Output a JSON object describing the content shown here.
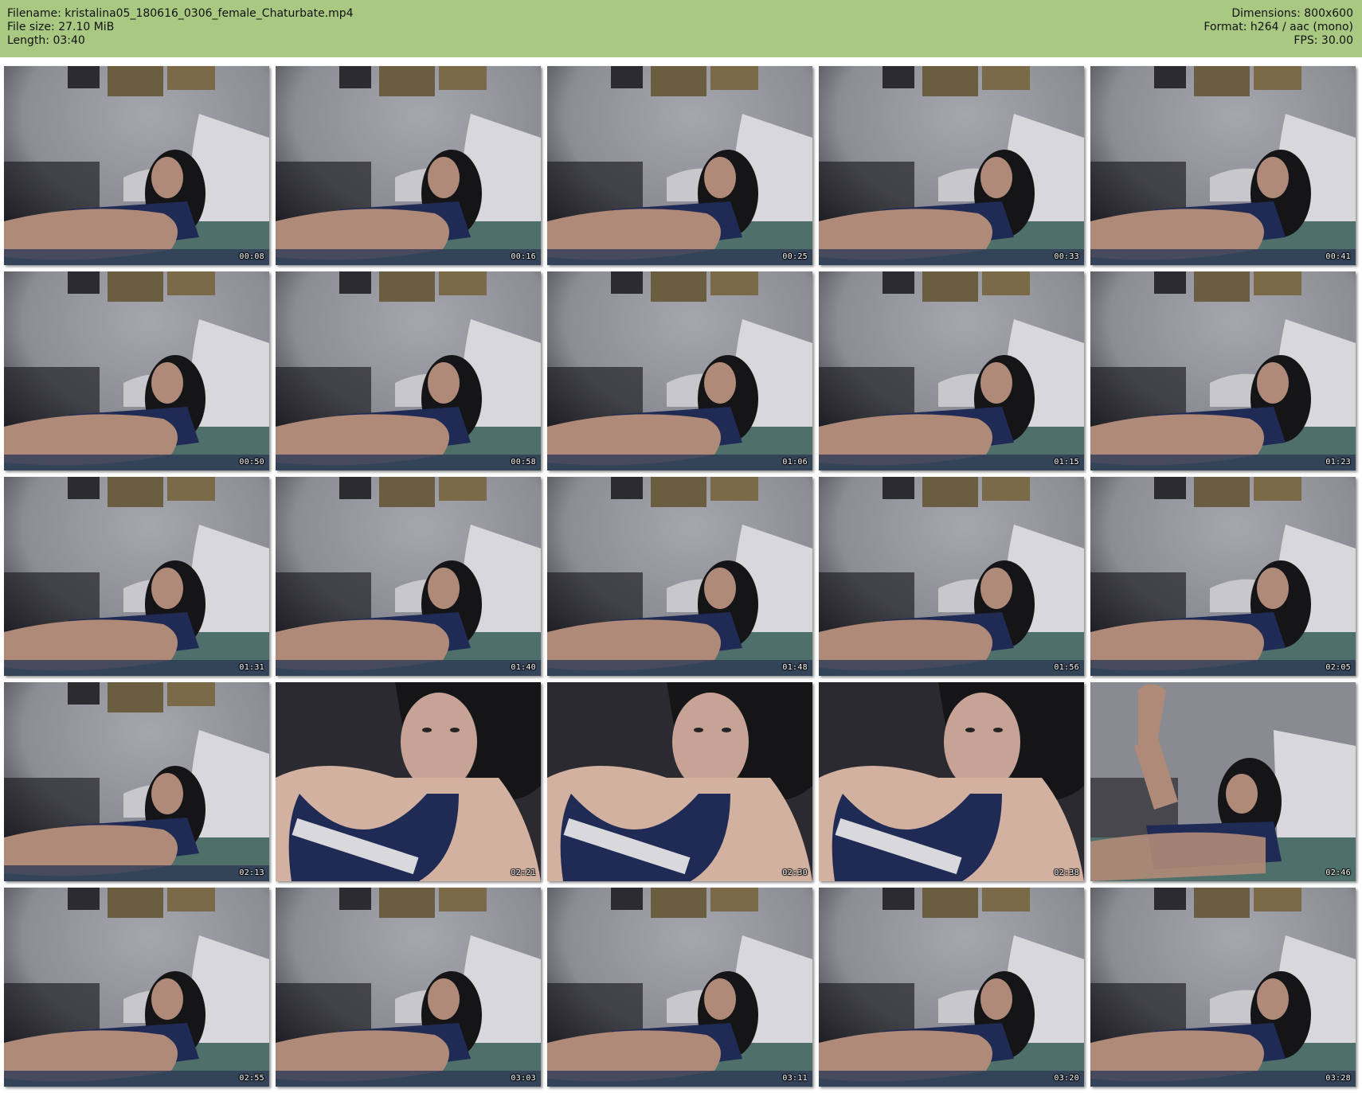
{
  "header": {
    "filename": "Filename: kristalina05_180616_0306_female_Chaturbate.mp4",
    "file_size": "File size: 27.10 MiB",
    "length": "Length: 03:40",
    "dimensions": "Dimensions: 800x600",
    "format": "Format: h264 / aac (mono)",
    "fps": "FPS: 30.00"
  },
  "colors": {
    "header_bg": "#a9c982",
    "wall": "#8c8c94",
    "shadow": "#1a1a20",
    "pillow": "#d8d8dc",
    "skin": "#b08a78",
    "hair": "#151518",
    "top": "#1f2a55",
    "sheet": "#4f6f6a"
  },
  "thumbnails": [
    {
      "time": "00:08",
      "scene": "lying"
    },
    {
      "time": "00:16",
      "scene": "lying"
    },
    {
      "time": "00:25",
      "scene": "lying"
    },
    {
      "time": "00:33",
      "scene": "lying"
    },
    {
      "time": "00:41",
      "scene": "lying"
    },
    {
      "time": "00:50",
      "scene": "lying"
    },
    {
      "time": "00:58",
      "scene": "lying"
    },
    {
      "time": "01:06",
      "scene": "lying"
    },
    {
      "time": "01:15",
      "scene": "lying"
    },
    {
      "time": "01:23",
      "scene": "lying"
    },
    {
      "time": "01:31",
      "scene": "lying"
    },
    {
      "time": "01:40",
      "scene": "lying"
    },
    {
      "time": "01:48",
      "scene": "lying"
    },
    {
      "time": "01:56",
      "scene": "lying"
    },
    {
      "time": "02:05",
      "scene": "lying"
    },
    {
      "time": "02:13",
      "scene": "lying"
    },
    {
      "time": "02:21",
      "scene": "closeup"
    },
    {
      "time": "02:30",
      "scene": "closeup"
    },
    {
      "time": "02:38",
      "scene": "closeup"
    },
    {
      "time": "02:46",
      "scene": "wave"
    },
    {
      "time": "02:55",
      "scene": "lying"
    },
    {
      "time": "03:03",
      "scene": "lying"
    },
    {
      "time": "03:11",
      "scene": "lying"
    },
    {
      "time": "03:20",
      "scene": "lying"
    },
    {
      "time": "03:28",
      "scene": "lying"
    }
  ]
}
